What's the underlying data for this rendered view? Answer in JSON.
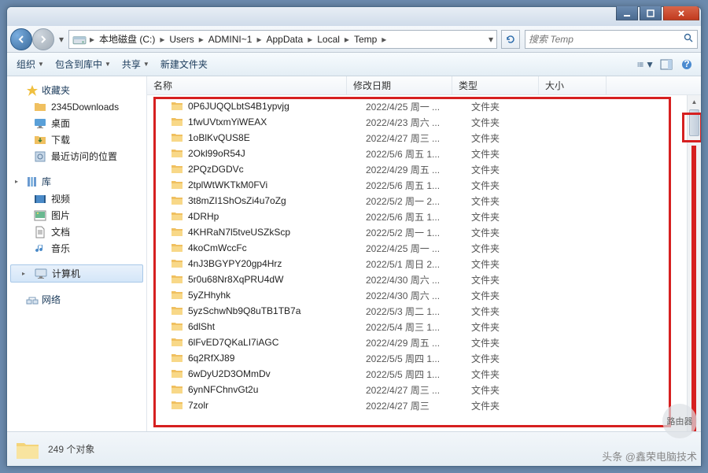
{
  "titlebar": {},
  "nav": {
    "breadcrumb": [
      "本地磁盘 (C:)",
      "Users",
      "ADMINI~1",
      "AppData",
      "Local",
      "Temp"
    ]
  },
  "search": {
    "placeholder": "搜索 Temp"
  },
  "toolbar": {
    "organize": "组织",
    "include": "包含到库中",
    "share": "共享",
    "newfolder": "新建文件夹"
  },
  "columns": {
    "name": "名称",
    "date": "修改日期",
    "type": "类型",
    "size": "大小"
  },
  "sidebar": {
    "favorites": {
      "label": "收藏夹",
      "items": [
        "2345Downloads",
        "桌面",
        "下载",
        "最近访问的位置"
      ]
    },
    "libraries": {
      "label": "库",
      "items": [
        "视频",
        "图片",
        "文档",
        "音乐"
      ]
    },
    "computer": {
      "label": "计算机"
    },
    "network": {
      "label": "网络"
    }
  },
  "files": [
    {
      "name": "0P6JUQQLbtS4B1ypvjg",
      "date": "2022/4/25 周一 ...",
      "type": "文件夹"
    },
    {
      "name": "1fwUVtxmYiWEAX",
      "date": "2022/4/23 周六 ...",
      "type": "文件夹"
    },
    {
      "name": "1oBlKvQUS8E",
      "date": "2022/4/27 周三 ...",
      "type": "文件夹"
    },
    {
      "name": "2Okl99oR54J",
      "date": "2022/5/6 周五 1...",
      "type": "文件夹"
    },
    {
      "name": "2PQzDGDVc",
      "date": "2022/4/29 周五 ...",
      "type": "文件夹"
    },
    {
      "name": "2tplWtWKTkM0FVi",
      "date": "2022/5/6 周五 1...",
      "type": "文件夹"
    },
    {
      "name": "3t8mZI1ShOsZi4u7oZg",
      "date": "2022/5/2 周一 2...",
      "type": "文件夹"
    },
    {
      "name": "4DRHp",
      "date": "2022/5/6 周五 1...",
      "type": "文件夹"
    },
    {
      "name": "4KHRaN7l5tveUSZkScp",
      "date": "2022/5/2 周一 1...",
      "type": "文件夹"
    },
    {
      "name": "4koCmWccFc",
      "date": "2022/4/25 周一 ...",
      "type": "文件夹"
    },
    {
      "name": "4nJ3BGYPY20gp4Hrz",
      "date": "2022/5/1 周日 2...",
      "type": "文件夹"
    },
    {
      "name": "5r0u68Nr8XqPRU4dW",
      "date": "2022/4/30 周六 ...",
      "type": "文件夹"
    },
    {
      "name": "5yZHhyhk",
      "date": "2022/4/30 周六 ...",
      "type": "文件夹"
    },
    {
      "name": "5yzSchwNb9Q8uTB1TB7a",
      "date": "2022/5/3 周二 1...",
      "type": "文件夹"
    },
    {
      "name": "6dlSht",
      "date": "2022/5/4 周三 1...",
      "type": "文件夹"
    },
    {
      "name": "6lFvED7QKaLI7iAGC",
      "date": "2022/4/29 周五 ...",
      "type": "文件夹"
    },
    {
      "name": "6q2RfXJ89",
      "date": "2022/5/5 周四 1...",
      "type": "文件夹"
    },
    {
      "name": "6wDyU2D3OMmDv",
      "date": "2022/5/5 周四 1...",
      "type": "文件夹"
    },
    {
      "name": "6ynNFChnvGt2u",
      "date": "2022/4/27 周三 ...",
      "type": "文件夹"
    },
    {
      "name": "7zolr",
      "date": "2022/4/27 周三",
      "type": "文件夹"
    }
  ],
  "status": {
    "count_label": "249 个对象"
  },
  "watermark": {
    "byline": "头条 @鑫荣电脑技术",
    "badge": "路由器"
  }
}
